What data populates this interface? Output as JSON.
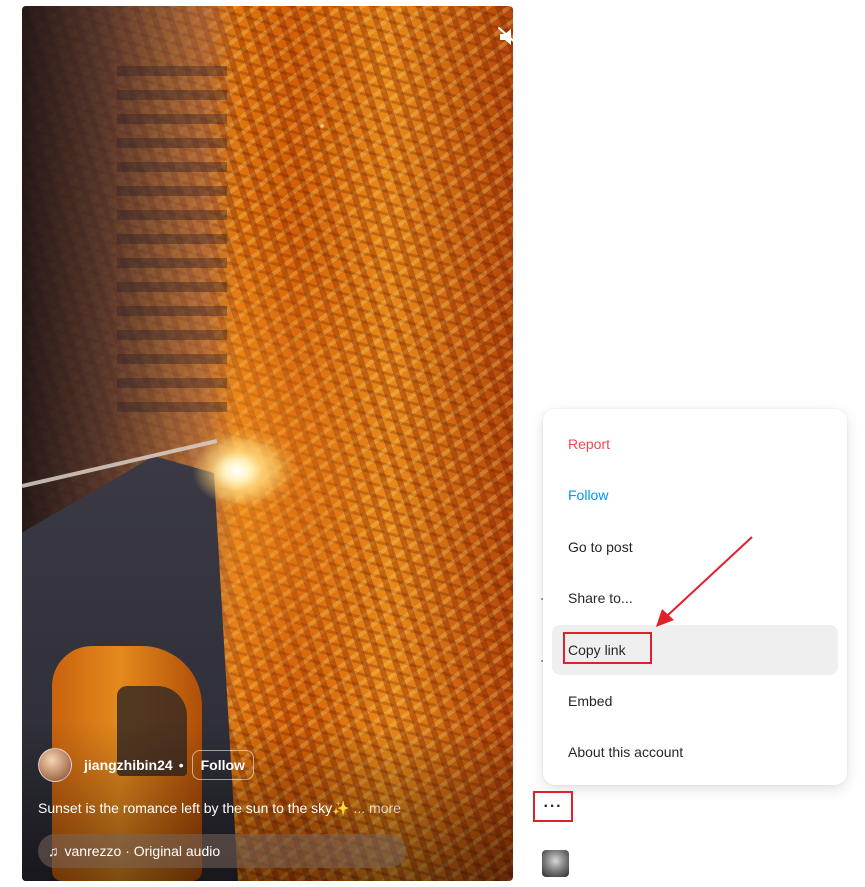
{
  "reel": {
    "username": "jiangzhibin24",
    "separator": "•",
    "follow_label": "Follow",
    "caption": "Sunset is the romance left by the sun to the sky✨",
    "caption_more": "... more",
    "audio": "vanrezzo · Original audio",
    "mute_icon": "speaker-muted-icon",
    "note_icon": "♫"
  },
  "menu": {
    "items": [
      {
        "label": "Report",
        "tone": "danger",
        "color": "#ed4956"
      },
      {
        "label": "Follow",
        "tone": "primary",
        "color": "#0095f6"
      },
      {
        "label": "Go to post",
        "tone": "default"
      },
      {
        "label": "Share to...",
        "tone": "default"
      },
      {
        "label": "Copy link",
        "tone": "default",
        "hovered": true
      },
      {
        "label": "Embed",
        "tone": "default"
      },
      {
        "label": "About this account",
        "tone": "default"
      }
    ]
  },
  "more_button": {
    "label": "···",
    "icon": "more-horizontal-icon"
  },
  "annotation": {
    "highlight_color": "#e0202a",
    "target": "Copy link"
  }
}
